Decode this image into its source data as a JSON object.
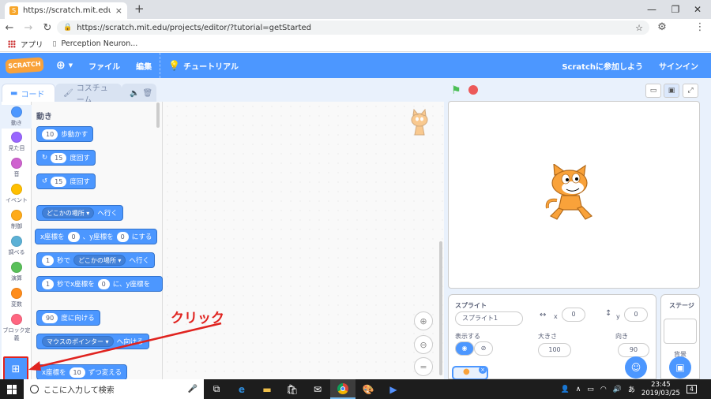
{
  "browser": {
    "tab_title": "https://scratch.mit.edu/projects/e",
    "tab_favicon": "S",
    "tab_close": "×",
    "new_tab": "+",
    "window_controls": [
      "—",
      "❐",
      "✕"
    ],
    "url": "https://scratch.mit.edu/projects/editor/?tutorial=getStarted",
    "bookmarks": [
      "アプリ",
      "Perception Neuron..."
    ]
  },
  "scratch_menu": {
    "logo": "SCRATCH",
    "file": "ファイル",
    "edit": "編集",
    "tutorials": "チュートリアル",
    "join": "Scratchに参加しよう",
    "signin": "サインイン"
  },
  "editor_tabs": {
    "code": "コード",
    "costume": "コスチューム"
  },
  "categories": [
    {
      "label": "動き",
      "color": "#4c97ff"
    },
    {
      "label": "見た目",
      "color": "#9966ff"
    },
    {
      "label": "音",
      "color": "#cf63cf"
    },
    {
      "label": "イベント",
      "color": "#ffbf00"
    },
    {
      "label": "制御",
      "color": "#ffab19"
    },
    {
      "label": "調べる",
      "color": "#5cb1d6"
    },
    {
      "label": "演算",
      "color": "#59c059"
    },
    {
      "label": "変数",
      "color": "#ff8c1a"
    },
    {
      "label": "ブロック定義",
      "color": "#ff6680"
    }
  ],
  "palette": {
    "title": "動き",
    "blocks": {
      "move": {
        "value": "10",
        "text": "歩動かす"
      },
      "turn_right": {
        "value": "15",
        "text": "度回す"
      },
      "turn_left": {
        "value": "15",
        "text": "度回す"
      },
      "goto": {
        "dropdown": "どこかの場所",
        "text": "へ行く"
      },
      "gotoxy": {
        "x_label": "x座標を",
        "x": "0",
        "y_label": "、y座標を",
        "y": "0",
        "suffix": "にする"
      },
      "glide": {
        "value": "1",
        "mid": "秒で",
        "dropdown": "どこかの場所",
        "text": "へ行く"
      },
      "glidexy": {
        "value": "1",
        "mid": "秒でx座標を",
        "x": "0",
        "y_label": "に、y座標を"
      },
      "point": {
        "value": "90",
        "text": "度に向ける"
      },
      "pointtowards": {
        "dropdown": "マウスのポインター",
        "text": "へ向ける"
      },
      "changex": {
        "label": "x座標を",
        "value": "10",
        "text": "ずつ変える"
      }
    }
  },
  "annotation": "クリック",
  "sprite_info": {
    "header": "スプライト",
    "name": "スプライト1",
    "x_label": "x",
    "x": "0",
    "y_label": "y",
    "y": "0",
    "show_label": "表示する",
    "size_label": "大きさ",
    "size": "100",
    "direction_label": "向き",
    "direction": "90"
  },
  "stage_panel": {
    "header": "ステージ",
    "backdrop_label": "背景"
  },
  "taskbar": {
    "search_placeholder": "ここに入力して検索",
    "time": "23:45",
    "date": "2019/03/25",
    "notifications": "4"
  }
}
